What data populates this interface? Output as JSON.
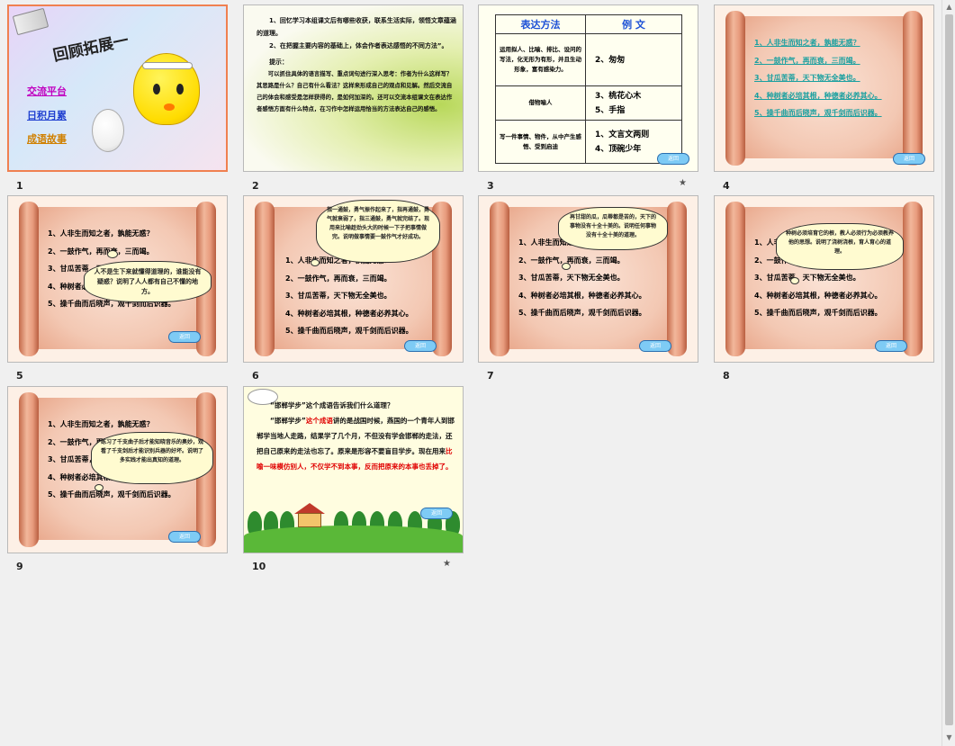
{
  "slides": [
    {
      "number": "1"
    },
    {
      "number": "2"
    },
    {
      "number": "3"
    },
    {
      "number": "4"
    },
    {
      "number": "5"
    },
    {
      "number": "6"
    },
    {
      "number": "7"
    },
    {
      "number": "8"
    },
    {
      "number": "9"
    },
    {
      "number": "10"
    }
  ],
  "s1": {
    "title": "回顾拓展一",
    "menu": [
      "交流平台",
      "日积月累",
      "成语故事"
    ],
    "menu_colors": [
      "#c000c0",
      "#2040d0",
      "#d08000"
    ]
  },
  "s2": {
    "p1": "1、回忆学习本组课文后有哪些收获，联系生活实际，领悟文章蕴涵的道理。",
    "p2": "2、在把握主要内容的基础上，体会作者表达感悟的不同方法”。",
    "hint_label": "提示：",
    "hint": "可以抓住具体的语言描写、重点词句进行深入思考：作者为什么这样写？其思路是什么？自己有什么看法？这样来形成自己的观点和见解。然后交流自己的体会和感受是怎样获得的，是如何加深的。还可以交流本组课文在表达作者感悟方面有什么特点，在习作中怎样运用恰当的方法表达自己的感悟。"
  },
  "s3": {
    "head_method": "表达方法",
    "head_example": "例  文",
    "rows": [
      {
        "method": "运用拟人、比喻、排比、设问的写法，化无形为有形，并且生动形象，富有感染力。",
        "examples": [
          "2、匆匆"
        ]
      },
      {
        "method": "借物喻人",
        "examples": [
          "3、桃花心木",
          "5、手指"
        ]
      },
      {
        "method": "写一件事情、物件，从中产生感悟、受到启迪",
        "examples": [
          "1、文言文两则",
          "4、顶碗少年"
        ]
      }
    ]
  },
  "proverbs": [
    "1、人非生而知之者，孰能无惑？",
    "2、一鼓作气，再而衰，三而竭。",
    "3、甘瓜苦蒂，天下物无全美也。",
    "4、种树者必培其根，种德者必养其心。",
    "5、操千曲而后晓声，观千剑而后识器。"
  ],
  "return_label": "返回",
  "bubbles": {
    "s5": "人不是生下来就懂得道理的，谁能没有疑惑？说明了人人都有自己不懂的地方。",
    "s6": "指一通鼓，勇气振作起来了，指再通鼓，勇气就衰弱了，指三通鼓，勇气就完结了。现用来比喻趁劲头大的时候一下子把事情做完。说明做事情要一鼓作气才好成功。",
    "s7": "再甘甜的瓜，瓜蒂都是苦的，天下的事物没有十全十美的。说明任何事物没有十全十美的道理。",
    "s8": "种树必须培育它的根，教人必须行为必须教养他的思想。说明了浇树浇根，育人育心的道理。",
    "s9": "练习了千支曲子后才能知晓音乐的奥妙，观看了千支剑后才能识别兵器的好坏。说明了多实践才能出真知的道理。"
  },
  "s10": {
    "q": "“邯郸学步”这个成语告诉我们什么道理？",
    "p_start": "“邯郸学步”",
    "p_red1": "这个成语",
    "p_mid": "讲的是战国时候，燕国的一个青年人到邯郸学当地人走路，结果学了几个月，不但没有学会邯郸的走法，还把自己原来的走法也忘了。原来是形容不要盲目学步。现在用来",
    "p_red2": "比喻一味模仿别人，不仅学不到本事，反而把原来的本事也丢掉了。"
  },
  "colors": {
    "selected_border": "#f08050",
    "link_teal": "#1ba0a0",
    "red": "#e00000",
    "blue": "#1a4fd6"
  }
}
